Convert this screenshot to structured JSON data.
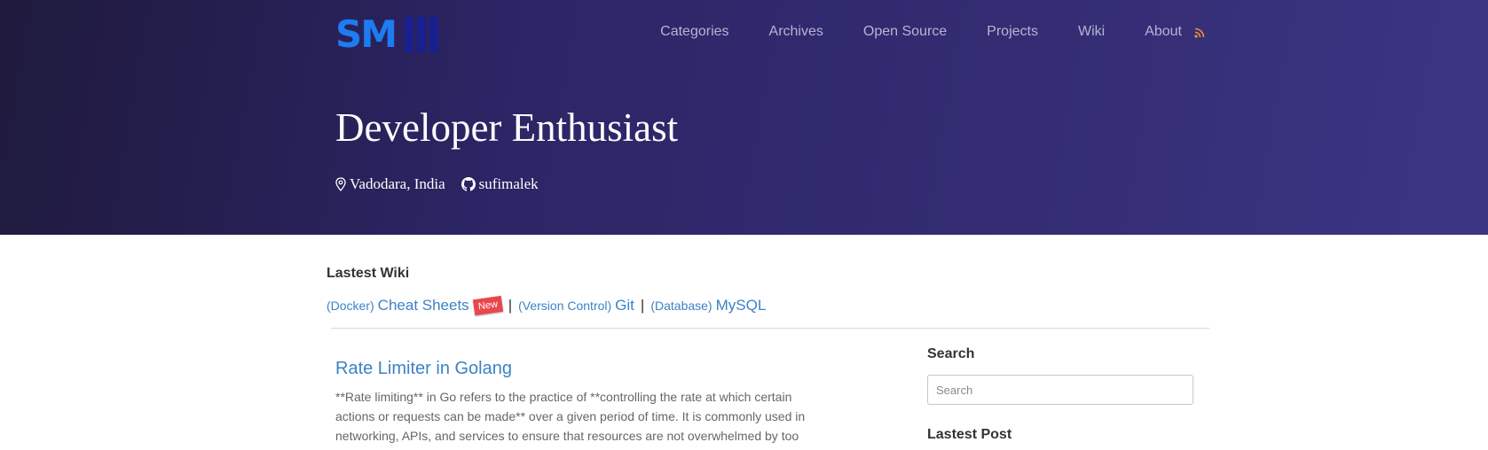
{
  "brand": {
    "text": "SM"
  },
  "nav": {
    "items": [
      "Categories",
      "Archives",
      "Open Source",
      "Projects",
      "Wiki",
      "About"
    ]
  },
  "hero": {
    "title": "Developer Enthusiast",
    "location": "Vadodara, India",
    "github": "sufimalek"
  },
  "wiki": {
    "heading": "Lastest Wiki",
    "entries": [
      {
        "category": "(Docker)",
        "title": "Cheat Sheets",
        "badge": "New"
      },
      {
        "category": "(Version Control)",
        "title": "Git"
      },
      {
        "category": "(Database)",
        "title": "MySQL"
      }
    ],
    "separator": "|"
  },
  "post": {
    "title": "Rate Limiter in Golang",
    "excerpt": "**Rate limiting** in Go refers to the practice of **controlling the rate at which certain actions or requests can be made** over a given period of time. It is commonly used in networking, APIs, and services to ensure that resources are not overwhelmed by too"
  },
  "sidebar": {
    "search_heading": "Search",
    "search_placeholder": "Search",
    "latest_heading": "Lastest Post"
  },
  "colors": {
    "accent": "#3c82c5",
    "brand": "#1e7bf0",
    "badge": "#e8474c",
    "rss": "#f0932b"
  }
}
